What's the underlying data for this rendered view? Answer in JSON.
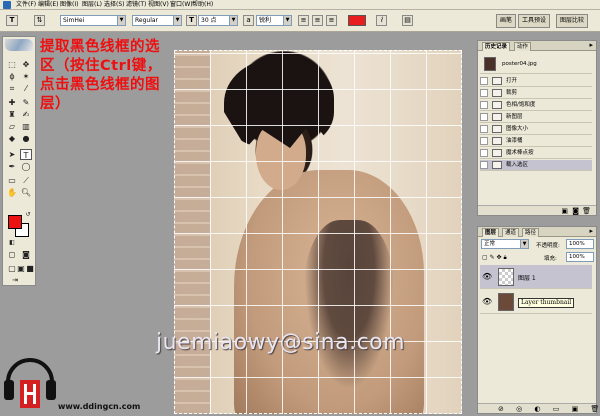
{
  "menu": {
    "items": [
      "文件(F)",
      "编辑(E)",
      "图像(I)",
      "图层(L)",
      "选择(S)",
      "滤镜(T)",
      "视图(V)",
      "窗口(W)",
      "帮助(H)"
    ]
  },
  "options": {
    "font_family": "SimHei",
    "font_style": "Regular",
    "font_size": "30 点",
    "antialias": "锐利",
    "text_color": "#e81e1e",
    "palette_tabs": [
      "画笔",
      "工具预设",
      "图层比较"
    ]
  },
  "annotation": "提取黑色线框的选区（按住Ctrl键，点击黑色线框的图层）",
  "watermark": "juemiaowy@sina.com",
  "history": {
    "tabs": [
      "历史记录",
      "动作"
    ],
    "snapshot": "poster04.jpg",
    "items": [
      "打开",
      "裁剪",
      "色相/饱和度",
      "新图层",
      "图像大小",
      "油漆桶",
      "魔术棒点按",
      "载入选区"
    ]
  },
  "layers": {
    "tabs": [
      "图层",
      "通道",
      "路径"
    ],
    "blend_mode": "正常",
    "opacity_label": "不透明度:",
    "opacity": "100%",
    "fill_label": "填充:",
    "fill": "100%",
    "items": [
      {
        "name": "图层 1"
      },
      {
        "name": "Layer thumbnail"
      }
    ]
  },
  "site": "www.ddingcn.com",
  "colors": {
    "foreground": "#ee1111",
    "background": "#ffffff"
  }
}
